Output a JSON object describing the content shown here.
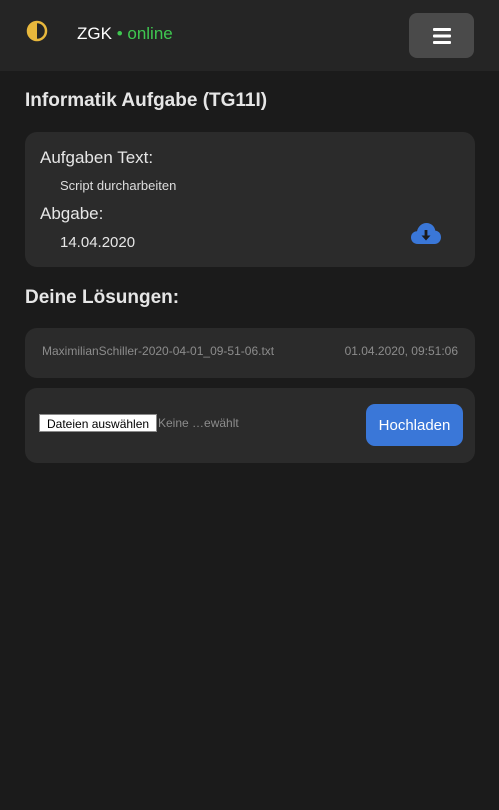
{
  "nav": {
    "brand_name": "ZGK",
    "status": "• online",
    "logo_icon": "half-moon-theme-icon",
    "menu_icon": "hamburger-menu-icon"
  },
  "task": {
    "title": "Informatik Aufgabe (TG11I)",
    "text_label": "Aufgaben Text:",
    "text_value": "Script durcharbeiten",
    "due_label": "Abgabe:",
    "due_value": "14.04.2020",
    "download_icon": "cloud-download-icon"
  },
  "solutions": {
    "title": "Deine Lösungen:",
    "files": [
      {
        "name": "MaximilianSchiller-2020-04-01_09-51-06.txt",
        "date": "01.04.2020, 09:51:06"
      }
    ]
  },
  "upload": {
    "choose_label": "Dateien auswählen",
    "no_file_text": "Keine …ewählt",
    "submit_label": "Hochladen"
  },
  "colors": {
    "background": "#1b1b1b",
    "navbar": "#252525",
    "card": "#2b2b2b",
    "online": "#3fc750",
    "accent": "#3a77d8",
    "logo": "#e8b83c"
  }
}
